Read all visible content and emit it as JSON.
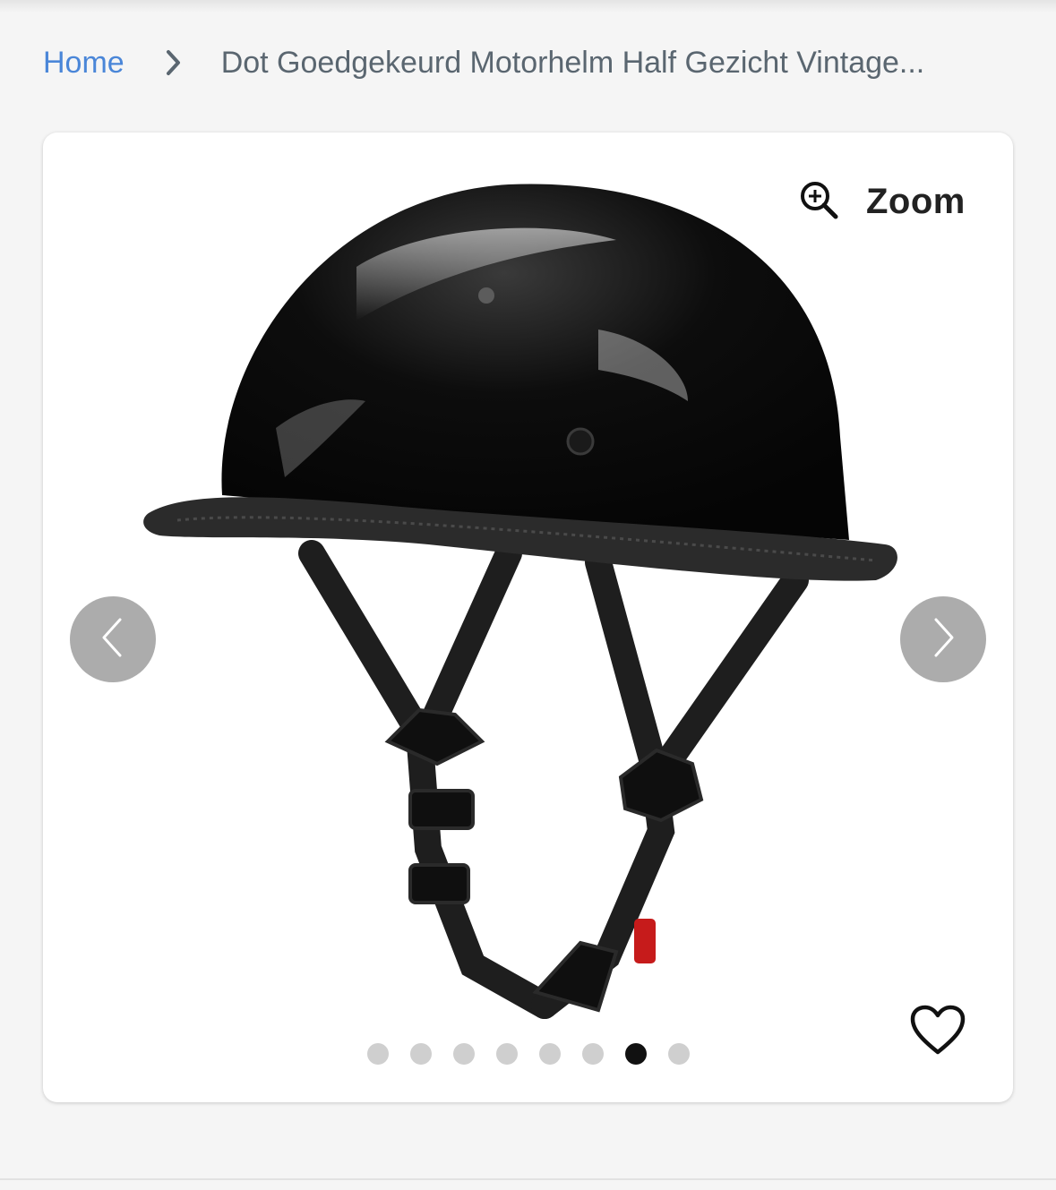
{
  "breadcrumb": {
    "home_label": "Home",
    "current_label": "Dot Goedgekeurd Motorhelm Half Gezicht Vintage..."
  },
  "gallery": {
    "zoom_label": "Zoom",
    "total_images": 8,
    "active_index": 6,
    "icons": {
      "zoom": "zoom-in-icon",
      "prev": "chevron-left-icon",
      "next": "chevron-right-icon",
      "favorite": "heart-icon"
    }
  },
  "colors": {
    "link": "#4a86d8",
    "text_muted": "#5a6670",
    "dot_active": "#111111",
    "dot_inactive": "#cfcfcf"
  }
}
